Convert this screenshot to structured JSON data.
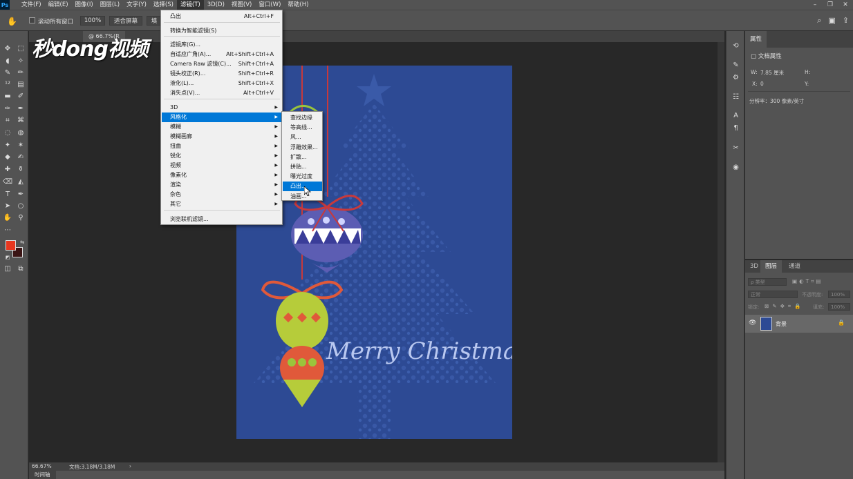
{
  "app": {
    "logo": "Ps"
  },
  "menubar": {
    "items": [
      "文件(F)",
      "编辑(E)",
      "图像(I)",
      "图层(L)",
      "文字(Y)",
      "选择(S)",
      "滤镜(T)",
      "3D(D)",
      "视图(V)",
      "窗口(W)",
      "帮助(H)"
    ],
    "active_index": 6
  },
  "window_controls": {
    "minimize": "–",
    "restore": "❐",
    "close": "✕"
  },
  "options_bar": {
    "scroll_all_label": "滚动所有窗口",
    "zoom_value": "100%",
    "fit_screen": "适合屏幕",
    "fill_screen": "填"
  },
  "document": {
    "tab_label": "@ 66.7%(R",
    "zoom": "66.67%",
    "doc_size": "文档:3.18M/3.18M",
    "artwork_text": "Merry Christmas"
  },
  "watermark": {
    "text": "秒dong视频"
  },
  "timeline": {
    "label": "时间轴"
  },
  "filter_menu": {
    "items": [
      {
        "label": "凸出",
        "shortcut": "Alt+Ctrl+F"
      },
      {
        "label": "转换为智能滤镜(S)",
        "shortcut": ""
      },
      {
        "label": "滤镜库(G)...",
        "shortcut": ""
      },
      {
        "label": "自适应广角(A)...",
        "shortcut": "Alt+Shift+Ctrl+A"
      },
      {
        "label": "Camera Raw 滤镜(C)...",
        "shortcut": "Shift+Ctrl+A"
      },
      {
        "label": "镜头校正(R)...",
        "shortcut": "Shift+Ctrl+R"
      },
      {
        "label": "液化(L)...",
        "shortcut": "Shift+Ctrl+X"
      },
      {
        "label": "消失点(V)...",
        "shortcut": "Alt+Ctrl+V"
      },
      {
        "label": "3D",
        "shortcut": ""
      },
      {
        "label": "风格化",
        "shortcut": ""
      },
      {
        "label": "模糊",
        "shortcut": ""
      },
      {
        "label": "模糊画廊",
        "shortcut": ""
      },
      {
        "label": "扭曲",
        "shortcut": ""
      },
      {
        "label": "锐化",
        "shortcut": ""
      },
      {
        "label": "视频",
        "shortcut": ""
      },
      {
        "label": "像素化",
        "shortcut": ""
      },
      {
        "label": "渲染",
        "shortcut": ""
      },
      {
        "label": "杂色",
        "shortcut": ""
      },
      {
        "label": "其它",
        "shortcut": ""
      },
      {
        "label": "浏览联机滤镜...",
        "shortcut": ""
      }
    ]
  },
  "stylize_submenu": {
    "items": [
      "查找边缘",
      "等高线...",
      "风...",
      "浮雕效果...",
      "扩散...",
      "拼贴...",
      "曝光过度",
      "凸出...",
      "油画..."
    ],
    "highlighted_index": 7
  },
  "properties_panel": {
    "tab": "属性",
    "section": "文档属性",
    "width_label": "W:",
    "width_value": "7.85 厘米",
    "height_label": "H:",
    "x_label": "X:",
    "x_value": "0",
    "y_label": "Y:",
    "resolution": "分辨率：300 像素/英寸"
  },
  "layers_panel": {
    "tabs": [
      "3D",
      "图层",
      "通道"
    ],
    "active_tab": 1,
    "filter_placeholder": "ρ 类型",
    "blend_mode": "正常",
    "opacity_label": "不透明度:",
    "opacity_value": "100%",
    "lock_label": "锁定:",
    "fill_label": "填充:",
    "fill_value": "100%",
    "layer_name": "背景"
  },
  "colors": {
    "foreground": "#e8371f",
    "background": "#3a1414",
    "menu_highlight": "#0078d7",
    "canvas_blue": "#2d4a94"
  }
}
